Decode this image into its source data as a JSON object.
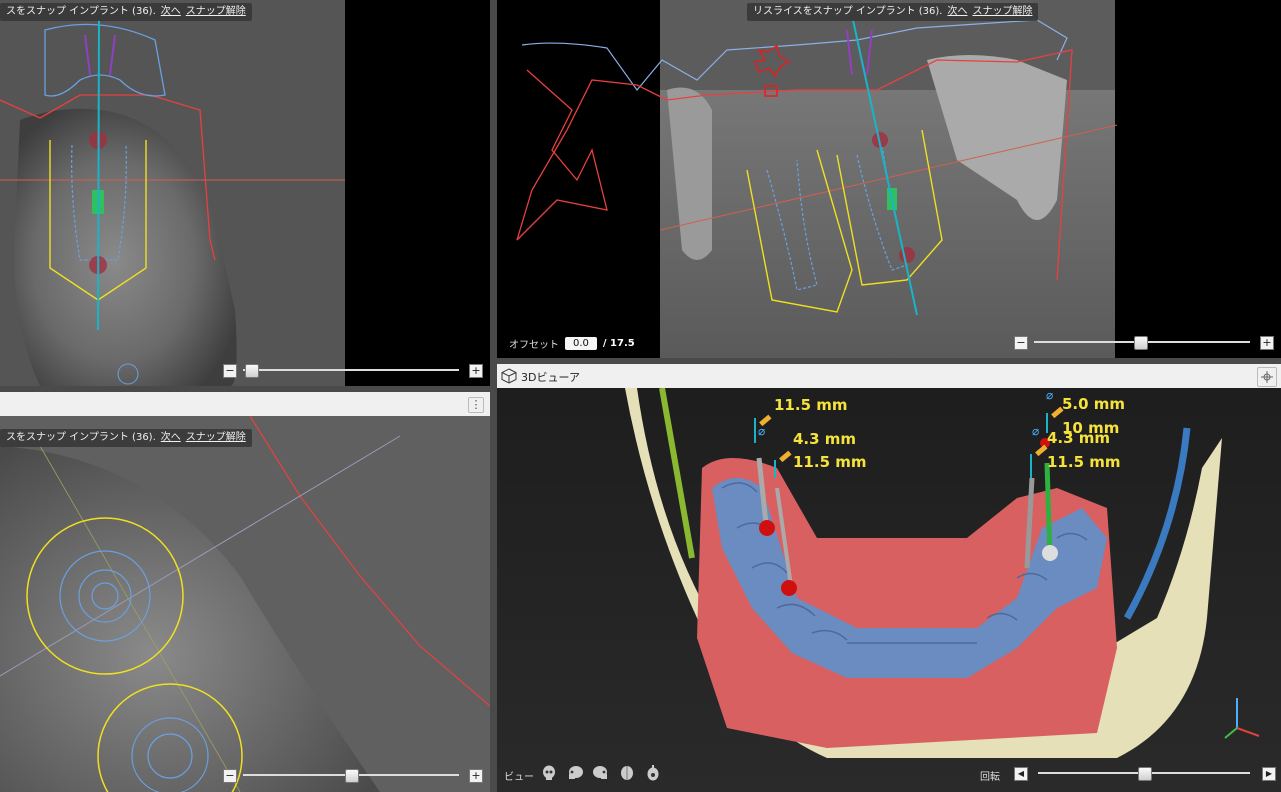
{
  "panels": {
    "top_left": {
      "banner_text": "スをスナップ インプラント (36).",
      "next_link": "次へ",
      "unsnap_link": "スナップ解除"
    },
    "top_right": {
      "banner_text": "リスライスをスナップ インプラント (36).",
      "next_link": "次へ",
      "unsnap_link": "スナップ解除",
      "offset_label": "オフセット",
      "offset_value": "0.0",
      "offset_max": "/ 17.5"
    },
    "bottom_left": {
      "banner_text": "スをスナップ インプラント (36).",
      "next_link": "次へ",
      "unsnap_link": "スナップ解除",
      "menu_glyph": "⋮"
    },
    "viewer_3d": {
      "title": "3Dビューア",
      "view_label": "ビュー",
      "rotate_label": "回転",
      "measurements": {
        "m1": "11.5 mm",
        "m2": "4.3 mm",
        "m3": "11.5 mm",
        "m4": "5.0 mm",
        "m5": "10 mm",
        "m6": "4.3 mm",
        "m7": "11.5 mm"
      },
      "diameter_symbol": "⌀",
      "view_icons": [
        "skull-front-icon",
        "skull-left-icon",
        "skull-right-icon",
        "skull-top-icon",
        "skull-bottom-icon"
      ]
    }
  },
  "slider_buttons": {
    "minus": "−",
    "plus": "+",
    "left": "◀",
    "right": "▶"
  },
  "colors": {
    "implant_axis": "#19b4c8",
    "outline_yellow": "#f0e020",
    "outline_blue": "#6aa0e0",
    "outline_red": "#e84040",
    "outline_purple": "#9040c0",
    "measure_text": "#f5e23a",
    "gum": "#d86060",
    "teeth": "#6a8cc0",
    "bone": "#e6e0b8"
  }
}
